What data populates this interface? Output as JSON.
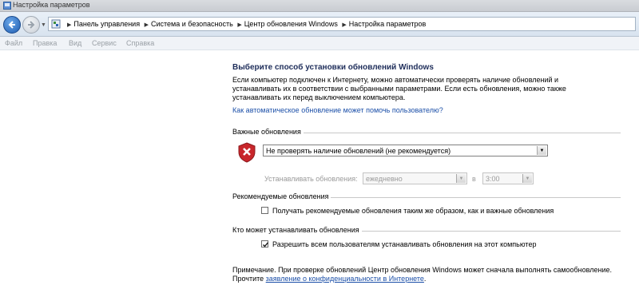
{
  "window": {
    "title": "Настройка параметров"
  },
  "address_bar": {
    "crumbs": [
      "Панель управления",
      "Система и безопасность",
      "Центр обновления Windows",
      "Настройка параметров"
    ]
  },
  "menu": {
    "items": [
      "Файл",
      "Правка",
      "Вид",
      "Сервис",
      "Справка"
    ]
  },
  "content": {
    "heading": "Выберите способ установки обновлений Windows",
    "intro": "Если компьютер подключен к Интернету, можно автоматически проверять наличие обновлений и устанавливать их в соответствии с выбранными параметрами. Если есть обновления, можно также устанавливать их перед выключением компьютера.",
    "help_link": "Как автоматическое обновление может помочь пользователю?",
    "important": {
      "group_label": "Важные обновления",
      "selected_option": "Не проверять наличие обновлений (не рекомендуется)",
      "install_label": "Устанавливать обновления:",
      "day_value": "ежедневно",
      "at_label": "в",
      "time_value": "3:00"
    },
    "recommended": {
      "group_label": "Рекомендуемые обновления",
      "checkbox_label": "Получать рекомендуемые обновления таким же образом, как и важные обновления",
      "checked": false
    },
    "who": {
      "group_label": "Кто может устанавливать обновления",
      "checkbox_label": "Разрешить всем пользователям устанавливать обновления на этот компьютер",
      "checked": true
    },
    "note_prefix": "Примечание. При проверке обновлений Центр обновления Windows может сначала выполнять самообновление. Прочтите",
    "note_link": "заявление о конфиденциальности в Интернете",
    "note_suffix": "."
  },
  "colors": {
    "heading": "#1e2d5a",
    "link": "#1b4fa8",
    "shield": "#c8262b"
  }
}
